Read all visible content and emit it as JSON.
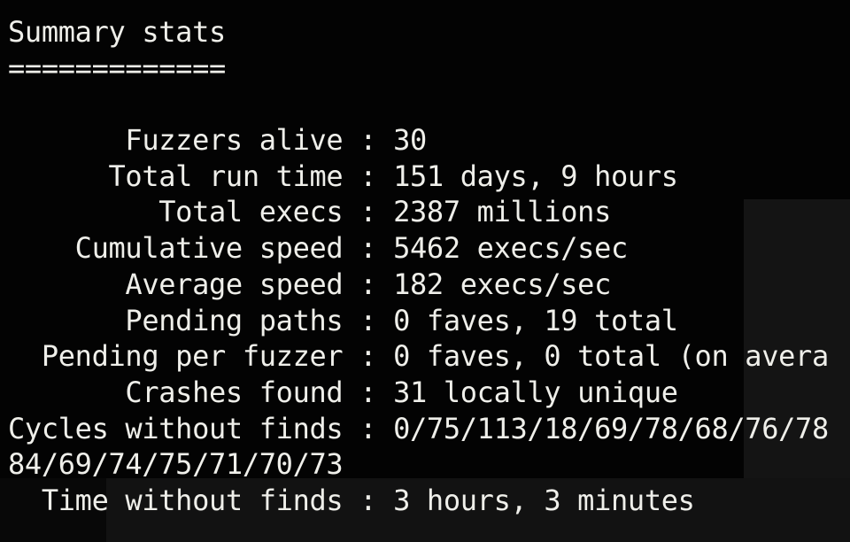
{
  "title": "Summary stats",
  "underline": "=============",
  "stats": [
    {
      "label": "       Fuzzers alive",
      "value": "30"
    },
    {
      "label": "      Total run time",
      "value": "151 days, 9 hours"
    },
    {
      "label": "         Total execs",
      "value": "2387 millions"
    },
    {
      "label": "    Cumulative speed",
      "value": "5462 execs/sec"
    },
    {
      "label": "       Average speed",
      "value": "182 execs/sec"
    },
    {
      "label": "       Pending paths",
      "value": "0 faves, 19 total"
    },
    {
      "label": "  Pending per fuzzer",
      "value": "0 faves, 0 total (on avera"
    },
    {
      "label": "       Crashes found",
      "value": "31 locally unique"
    },
    {
      "label": "Cycles without finds",
      "value": "0/75/113/18/69/78/68/76/78"
    }
  ],
  "wrapped_line": "84/69/74/75/71/70/73",
  "last_stat": {
    "label": "  Time without finds",
    "value": "3 hours, 3 minutes"
  },
  "separator": " : "
}
